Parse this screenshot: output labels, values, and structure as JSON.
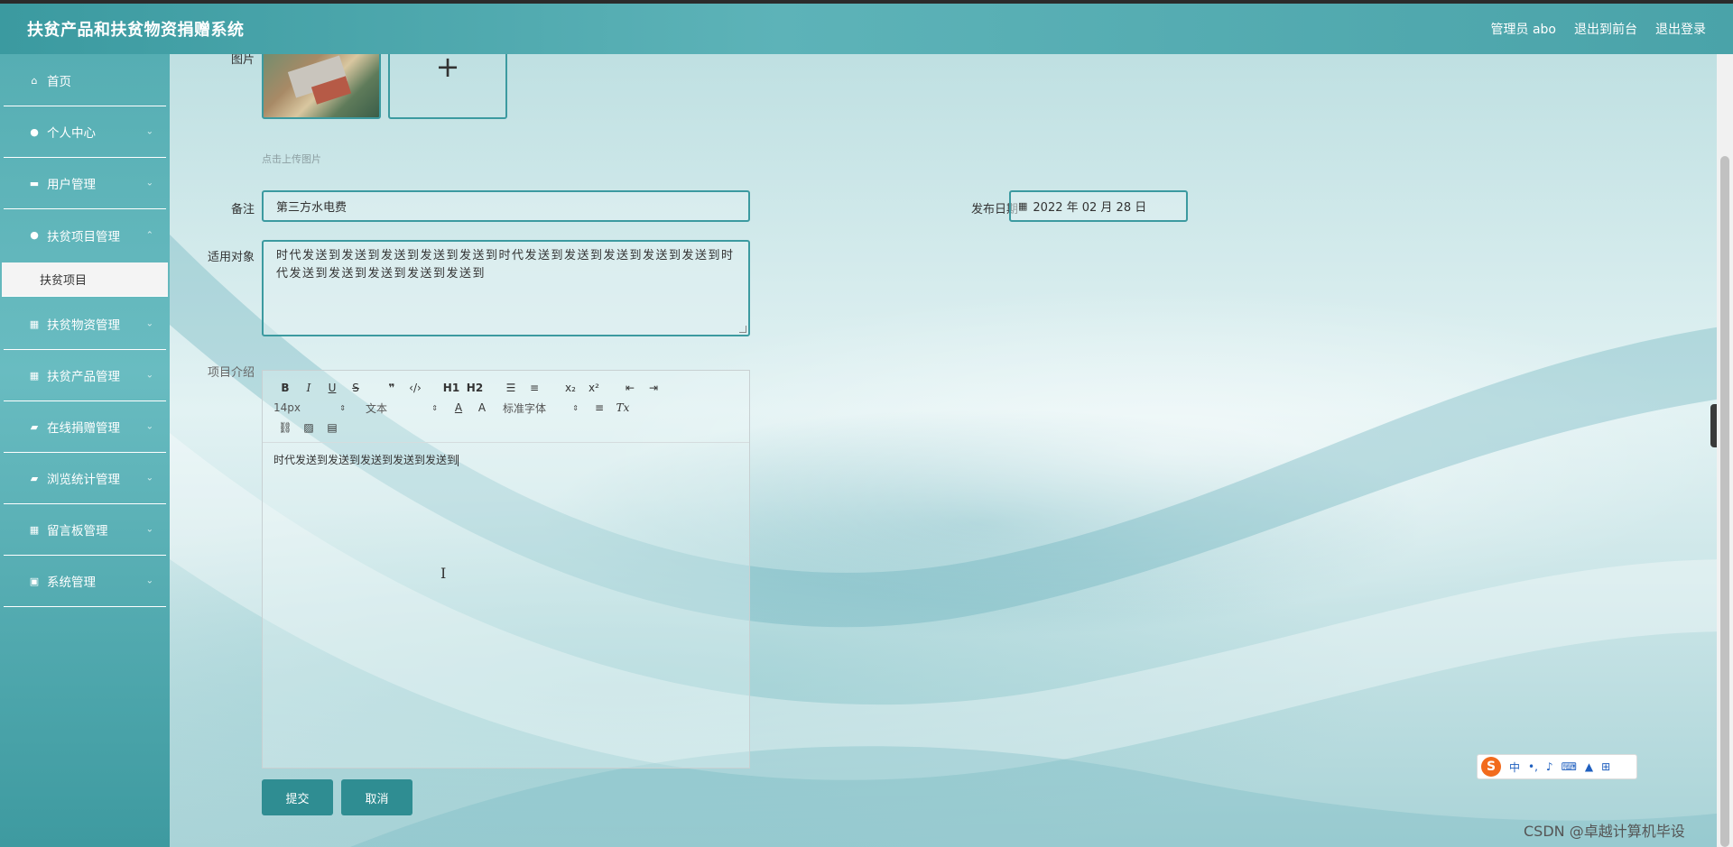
{
  "header": {
    "title": "扶贫产品和扶贫物资捐赠系统",
    "links": [
      "管理员 abo",
      "退出到前台",
      "退出登录"
    ]
  },
  "sidebar": {
    "items": [
      {
        "label": "首页",
        "icon": "home-icon",
        "glyph": "⌂",
        "chevron": false
      },
      {
        "label": "个人中心",
        "icon": "user-icon",
        "glyph": "●",
        "chevron": true
      },
      {
        "label": "用户管理",
        "icon": "id-card-icon",
        "glyph": "▬",
        "chevron": true
      },
      {
        "label": "扶贫项目管理",
        "icon": "user-icon",
        "glyph": "●",
        "chevron": true,
        "expanded": true
      },
      {
        "label": "扶贫物资管理",
        "icon": "grid-icon",
        "glyph": "▦",
        "chevron": true
      },
      {
        "label": "扶贫产品管理",
        "icon": "grid-icon",
        "glyph": "▦",
        "chevron": true
      },
      {
        "label": "在线捐赠管理",
        "icon": "chat-icon",
        "glyph": "▰",
        "chevron": true
      },
      {
        "label": "浏览统计管理",
        "icon": "briefcase-icon",
        "glyph": "▰",
        "chevron": true
      },
      {
        "label": "留言板管理",
        "icon": "grid-icon",
        "glyph": "▦",
        "chevron": true
      },
      {
        "label": "系统管理",
        "icon": "clipboard-icon",
        "glyph": "▣",
        "chevron": true
      }
    ],
    "sub_item": "扶贫项目"
  },
  "form": {
    "image_label": "图片",
    "upload_add": "+",
    "upload_hint": "点击上传图片",
    "remark_label": "备注",
    "remark_value": "第三方水电费",
    "date_label": "发布日期",
    "date_value": "2022 年 02 月 28 日",
    "target_label": "适用对象",
    "target_value": "时代发送到发送到发送到发送到发送到时代发送到发送到发送到发送到发送到时代发送到发送到发送到发送到发送到",
    "intro_label": "项目介绍",
    "intro_value": "时代发送到发送到发送到发送到发送到",
    "submit": "提交",
    "cancel": "取消"
  },
  "editor": {
    "row1": [
      "B",
      "I",
      "U",
      "S",
      "❞",
      "‹/›",
      "H1",
      "H2",
      "☰",
      "≡",
      "x₂",
      "x²",
      "⇤",
      "⇥"
    ],
    "size_select": "14px",
    "text_select": "文本",
    "font_select": "标准字体",
    "row2_icons": [
      "A",
      "A",
      "≡",
      "Tx"
    ],
    "row3_icons": [
      "⛓",
      "▨",
      "▤"
    ]
  },
  "ime": {
    "logo": "S",
    "items": [
      "中",
      "•,",
      "♪",
      "⌨",
      "▲",
      "⊞"
    ]
  },
  "watermark": "CSDN @卓越计算机毕设",
  "colors": {
    "accent": "#3c9aa0",
    "button": "#2f8d92",
    "sidebar": "#56aeb3"
  }
}
